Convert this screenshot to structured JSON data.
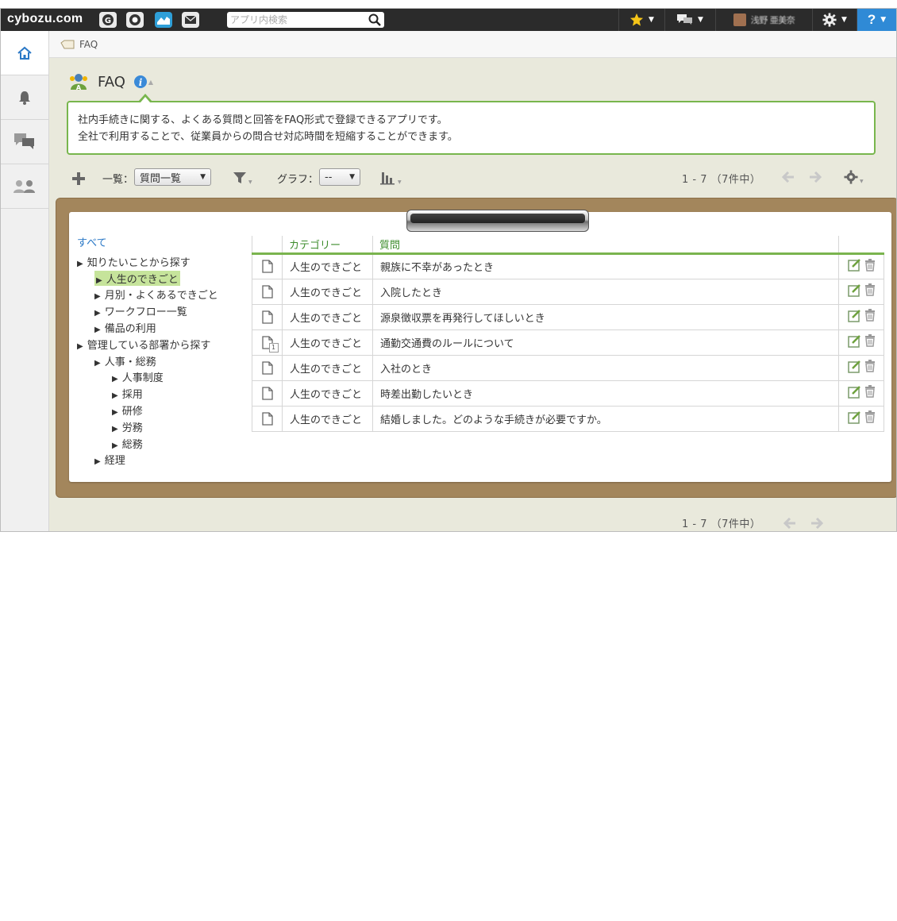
{
  "topbar": {
    "logo": "cybozu.com",
    "services": [
      "garoon-icon",
      "office-icon",
      "kintone-icon",
      "mail-icon"
    ],
    "search_placeholder": "アプリ内検索",
    "favorites_icon": "star-icon",
    "messages_icon": "chat-icon",
    "user_name": "浅野 亜美奈",
    "settings_icon": "gear-icon",
    "help_label": "?"
  },
  "sidebar": {
    "items": [
      "home-icon",
      "bell-icon",
      "people-chat-icon",
      "people-icon"
    ],
    "active": "home-icon"
  },
  "breadcrumb": {
    "label": "FAQ"
  },
  "app": {
    "title": "FAQ",
    "description_line1": "社内手続きに関する、よくある質問と回答をFAQ形式で登録できるアプリです。",
    "description_line2": "全社で利用することで、従業員からの問合せ対応時間を短縮することができます。"
  },
  "toolbar": {
    "view_label": "一覧：",
    "view_value": "質問一覧",
    "graph_label": "グラフ：",
    "graph_value": "--",
    "pagination": "1 - 7 （7件中）"
  },
  "tree": {
    "all_label": "すべて",
    "items": [
      {
        "label": "知りたいことから探す",
        "level": 0,
        "selected": false
      },
      {
        "label": "人生のできごと",
        "level": 1,
        "selected": true
      },
      {
        "label": "月別・よくあるできごと",
        "level": 1,
        "selected": false
      },
      {
        "label": "ワークフロー一覧",
        "level": 1,
        "selected": false
      },
      {
        "label": "備品の利用",
        "level": 1,
        "selected": false
      },
      {
        "label": "管理している部署から探す",
        "level": 0,
        "selected": false
      },
      {
        "label": "人事・総務",
        "level": 1,
        "selected": false
      },
      {
        "label": "人事制度",
        "level": 2,
        "selected": false
      },
      {
        "label": "採用",
        "level": 2,
        "selected": false
      },
      {
        "label": "研修",
        "level": 2,
        "selected": false
      },
      {
        "label": "労務",
        "level": 2,
        "selected": false
      },
      {
        "label": "総務",
        "level": 2,
        "selected": false
      },
      {
        "label": "経理",
        "level": 1,
        "selected": false
      }
    ]
  },
  "table": {
    "headers": [
      "カテゴリー",
      "質問"
    ],
    "rows": [
      {
        "category": "人生のできごと",
        "question": "親族に不幸があったとき",
        "comments": ""
      },
      {
        "category": "人生のできごと",
        "question": "入院したとき",
        "comments": ""
      },
      {
        "category": "人生のできごと",
        "question": "源泉徴収票を再発行してほしいとき",
        "comments": ""
      },
      {
        "category": "人生のできごと",
        "question": "通勤交通費のルールについて",
        "comments": "1"
      },
      {
        "category": "人生のできごと",
        "question": "入社のとき",
        "comments": ""
      },
      {
        "category": "人生のできごと",
        "question": "時差出勤したいとき",
        "comments": ""
      },
      {
        "category": "人生のできごと",
        "question": "結婚しました。どのような手続きが必要ですか。",
        "comments": ""
      }
    ]
  },
  "footer": {
    "pagination": "1 - 7 （7件中）"
  },
  "colors": {
    "accent_green": "#78b64d",
    "board_brown": "#a3865c",
    "help_blue": "#2f8ad6",
    "link_blue": "#2a78c6"
  }
}
